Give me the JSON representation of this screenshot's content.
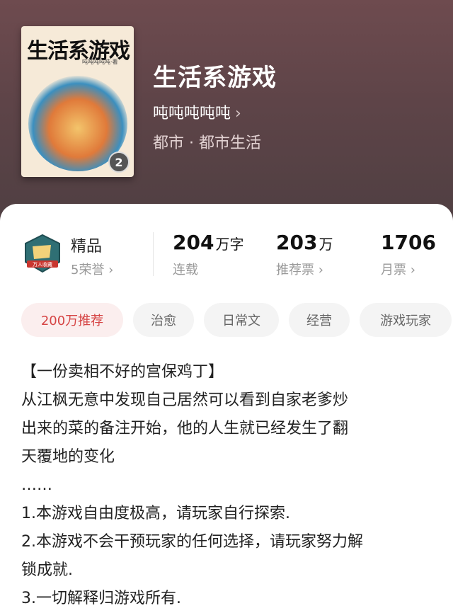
{
  "book": {
    "title": "生活系游戏",
    "author": "吨吨吨吨吨",
    "genre": "都市 · 都市生活",
    "cover": {
      "title_text": "生活系游戏",
      "author_text": "吨吨吨吨吨·著",
      "volume_badge": "2"
    }
  },
  "quality": {
    "label": "精品",
    "honors": "5荣誉",
    "emblem_text": "万人收藏"
  },
  "stats": [
    {
      "value": "204",
      "unit": "万字",
      "label": "连载"
    },
    {
      "value": "203",
      "unit": "万",
      "label": "推荐票"
    },
    {
      "value": "1706",
      "unit": "",
      "label": "月票"
    }
  ],
  "tags": [
    "200万推荐",
    "治愈",
    "日常文",
    "经营",
    "游戏玩家"
  ],
  "description": [
    "【一份卖相不好的宫保鸡丁】",
    "从江枫无意中发现自己居然可以看到自家老爹炒",
    "出来的菜的备注开始，他的人生就已经发生了翻",
    "天覆地的变化",
    "……",
    "1.本游戏自由度极高，请玩家自行探索.",
    "2.本游戏不会干预玩家的任何选择，请玩家努力解",
    "锁成就.",
    "3.一切解释归游戏所有."
  ],
  "colors": {
    "header_bg": "#5e4448",
    "accent_red": "#d64545",
    "tag_bg": "#f4f4f4"
  }
}
